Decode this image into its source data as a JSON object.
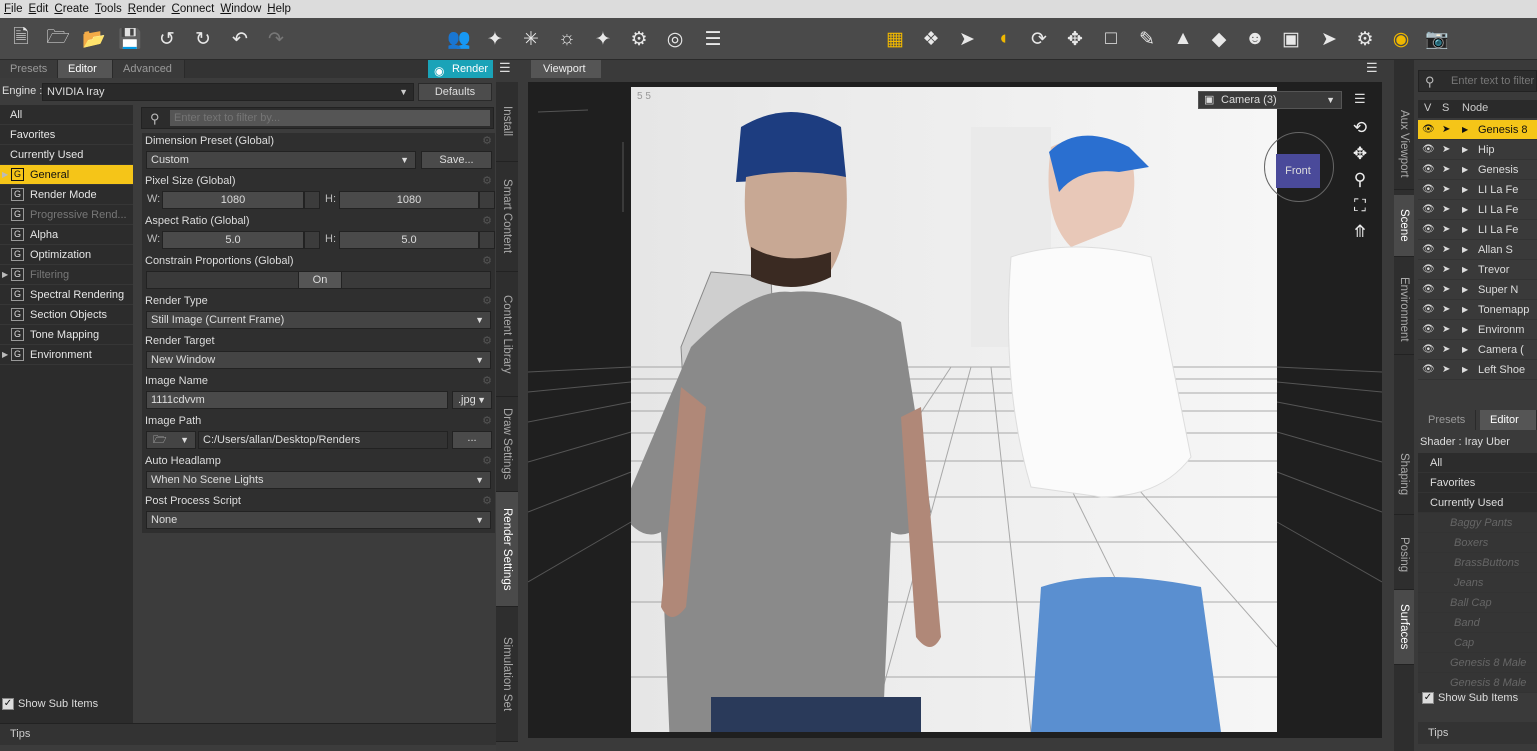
{
  "menu": [
    "File",
    "Edit",
    "Create",
    "Tools",
    "Render",
    "Connect",
    "Window",
    "Help"
  ],
  "left_tabs": [
    "Presets",
    "Editor",
    "Advanced"
  ],
  "render_button": "Render",
  "engine": {
    "label": "Engine :",
    "value": "NVIDIA Iray",
    "defaults": "Defaults"
  },
  "categories": [
    {
      "label": "All"
    },
    {
      "label": "Favorites"
    },
    {
      "label": "Currently Used"
    },
    {
      "label": "General",
      "group": true,
      "selected": true,
      "expand": true
    },
    {
      "label": "Render Mode",
      "group": true
    },
    {
      "label": "Progressive Rend...",
      "group": true,
      "disabled": true
    },
    {
      "label": "Alpha",
      "group": true
    },
    {
      "label": "Optimization",
      "group": true
    },
    {
      "label": "Filtering",
      "group": true,
      "disabled": true,
      "expand": true
    },
    {
      "label": "Spectral Rendering",
      "group": true
    },
    {
      "label": "Section Objects",
      "group": true
    },
    {
      "label": "Tone Mapping",
      "group": true
    },
    {
      "label": "Environment",
      "group": true,
      "expand": true
    }
  ],
  "show_sub_items": "Show Sub Items",
  "filter_placeholder": "Enter text to filter by...",
  "props": {
    "dimension_preset": {
      "title": "Dimension Preset (Global)",
      "value": "Custom",
      "save": "Save..."
    },
    "pixel_size": {
      "title": "Pixel Size (Global)",
      "w_label": "W:",
      "w": "1080",
      "h_label": "H:",
      "h": "1080"
    },
    "aspect_ratio": {
      "title": "Aspect Ratio (Global)",
      "w_label": "W:",
      "w": "5.0",
      "h_label": "H:",
      "h": "5.0"
    },
    "constrain": {
      "title": "Constrain Proportions (Global)",
      "value": "On"
    },
    "render_type": {
      "title": "Render Type",
      "value": "Still Image (Current Frame)"
    },
    "render_target": {
      "title": "Render Target",
      "value": "New Window"
    },
    "image_name": {
      "title": "Image Name",
      "value": "1111cdvvm",
      "ext": ".jpg"
    },
    "image_path": {
      "title": "Image Path",
      "value": "C:/Users/allan/Desktop/Renders",
      "browse": "..."
    },
    "auto_headlamp": {
      "title": "Auto Headlamp",
      "value": "When No Scene Lights"
    },
    "post_process": {
      "title": "Post Process Script",
      "value": "None"
    }
  },
  "tips": "Tips",
  "left_vtabs": [
    "Install",
    "Smart Content",
    "Content Library",
    "Draw Settings",
    "Render Settings",
    "Simulation Set"
  ],
  "viewport": {
    "tab": "Viewport",
    "camera": "Camera (3)",
    "cube": "Front",
    "corner": "5 5"
  },
  "right_search_placeholder": "Enter text to filter",
  "scene_headers": [
    "V",
    "S",
    "Node"
  ],
  "scene_nodes": [
    {
      "name": "Genesis 8",
      "selected": true
    },
    {
      "name": "Hip"
    },
    {
      "name": "Genesis"
    },
    {
      "name": "LI La Fe"
    },
    {
      "name": "LI La Fe"
    },
    {
      "name": "LI La Fe"
    },
    {
      "name": "Allan S"
    },
    {
      "name": "Trevor"
    },
    {
      "name": "Super N"
    },
    {
      "name": "Tonemapp"
    },
    {
      "name": "Environm"
    },
    {
      "name": "Camera ("
    },
    {
      "name": "Left Shoe"
    }
  ],
  "right_tabs": [
    "Presets",
    "Editor"
  ],
  "shader": "Shader : Iray Uber",
  "surface_items": [
    {
      "label": "All"
    },
    {
      "label": "Favorites"
    },
    {
      "label": "Currently Used"
    },
    {
      "label": "Baggy Pants",
      "italic": true,
      "grp": true
    },
    {
      "label": "Boxers",
      "italic": true
    },
    {
      "label": "BrassButtons",
      "italic": true
    },
    {
      "label": "Jeans",
      "italic": true
    },
    {
      "label": "Ball Cap",
      "italic": true,
      "grp": true
    },
    {
      "label": "Band",
      "italic": true
    },
    {
      "label": "Cap",
      "italic": true
    },
    {
      "label": "Genesis 8 Male",
      "italic": true,
      "grp": true
    },
    {
      "label": "Genesis 8 Male",
      "italic": true,
      "grp": true
    }
  ],
  "right_vtabs": [
    "Aux Viewport",
    "Scene",
    "Environment",
    "Shaping",
    "Posing",
    "Surfaces"
  ]
}
